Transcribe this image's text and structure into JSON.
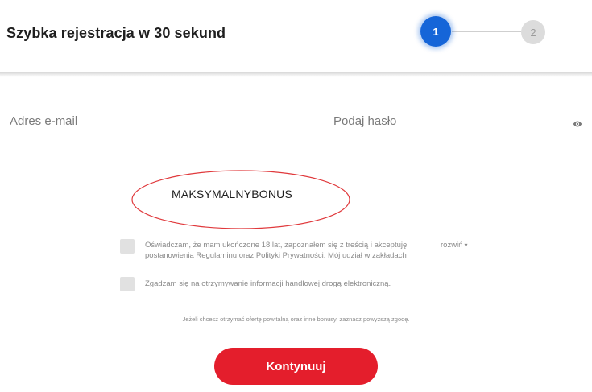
{
  "header": {
    "title": "Szybka rejestracja w 30 sekund",
    "steps": [
      {
        "number": "1",
        "active": true
      },
      {
        "number": "2",
        "active": false
      }
    ]
  },
  "form": {
    "email": {
      "placeholder": "Adres e-mail",
      "value": ""
    },
    "password": {
      "placeholder": "Podaj hasło",
      "value": "",
      "toggle_icon": "eye-icon"
    },
    "promo_code": {
      "value": "MAKSYMALNYBONUS",
      "highlight": "red-ellipse"
    },
    "consents": {
      "terms": {
        "text": "Oświadczam, że mam ukończone 18 lat, zapoznałem się z treścią i akceptuję postanowienia Regulaminu oraz Polityki Prywatności. Mój udział w zakładach",
        "expand_label": "rozwiń",
        "checked": false
      },
      "marketing": {
        "text": "Zgadzam się na otrzymywanie informacji handlowej drogą elektroniczną.",
        "checked": false
      }
    },
    "bonus_hint": "Jeżeli chcesz otrzymać ofertę powitalną oraz inne bonusy, zaznacz powyższą zgodę.",
    "submit_label": "Kontynuuj"
  },
  "colors": {
    "brand_red": "#e41e2c",
    "step_active": "#1565d8",
    "step_inactive": "#dcdcdc",
    "promo_underline": "#3dbb2f",
    "highlight_ellipse": "#e0393c"
  }
}
